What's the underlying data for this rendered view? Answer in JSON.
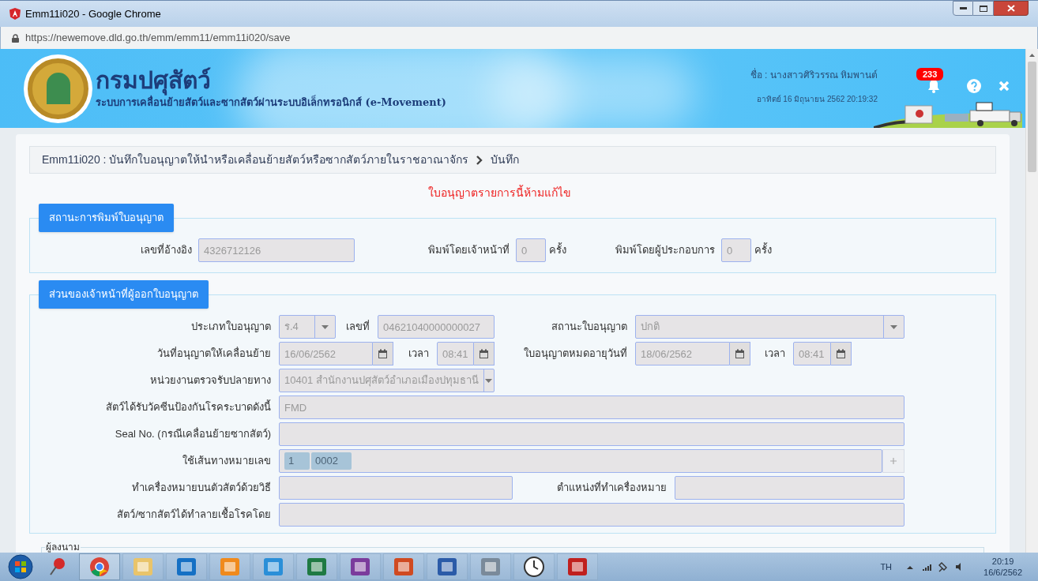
{
  "window": {
    "title": "Emm11i020 - Google Chrome",
    "url": "https://newemove.dld.go.th/emm/emm11/emm11i020/save"
  },
  "header": {
    "org_name": "กรมปศุสัตว์",
    "system_name": "ระบบการเคลื่อนย้ายสัตว์และซากสัตว์ผ่านระบบอิเล็กทรอนิกส์ (e-Movement)",
    "user_label": "ชื่อ :",
    "user_name": "นางสาวศิริวรรณ หิมพานต์",
    "datetime": "อาทิตย์ 16 มิถุนายน 2562 20:19:32",
    "notification_count": "233"
  },
  "breadcrumb": {
    "page": "Emm11i020 : บันทึกใบอนุญาตให้นำหรือเคลื่อนย้ายสัตว์หรือซากสัตว์ภายในราชอาณาจักร",
    "current": "บันทึก"
  },
  "notice": "ใบอนุญาตรายการนี้ห้ามแก้ไข",
  "print_status": {
    "heading": "สถานะการพิมพ์ใบอนุญาต",
    "fields": [
      {
        "label": "เลขที่อ้างอิง",
        "value": "4326712126"
      },
      {
        "label": "พิมพ์โดยเจ้าหน้าที่",
        "value": "0",
        "suffix": "ครั้ง"
      },
      {
        "label": "พิมพ์โดยผู้ประกอบการ",
        "value": "0",
        "suffix": "ครั้ง"
      }
    ]
  },
  "issuer_section": {
    "heading": "ส่วนของเจ้าหน้าที่ผู้ออกใบอนุญาต",
    "rows": [
      {
        "fields": [
          {
            "label": "ประเภทใบอนุญาต",
            "kind": "select",
            "value": "ร.4"
          },
          {
            "label": "เลขที่",
            "kind": "text",
            "value": "04621040000000027"
          },
          {
            "label": "สถานะใบอนุญาต",
            "kind": "select",
            "value": "ปกติ"
          }
        ]
      },
      {
        "fields": [
          {
            "label": "วันที่อนุญาตให้เคลื่อนย้าย",
            "kind": "date",
            "value": "16/06/2562"
          },
          {
            "label": "เวลา",
            "kind": "date",
            "value": "08:41"
          },
          {
            "label": "ใบอนุญาตหมดอายุวันที่",
            "kind": "date",
            "value": "18/06/2562"
          },
          {
            "label": "เวลา",
            "kind": "date",
            "value": "08:41"
          }
        ]
      },
      {
        "fields": [
          {
            "label": "หน่วยงานตรวจรับปลายทาง",
            "kind": "select",
            "value": "10401 สำนักงานปศุสัตว์อำเภอเมืองปทุมธานี"
          }
        ]
      },
      {
        "fields": [
          {
            "label": "สัตว์ได้รับวัคซีนป้องกันโรคระบาดดังนี้",
            "kind": "text",
            "value": "FMD"
          }
        ]
      },
      {
        "fields": [
          {
            "label": "Seal No. (กรณีเคลื่อนย้ายซากสัตว์)",
            "kind": "text"
          }
        ]
      },
      {
        "fields": [
          {
            "label": "ใช้เส้นทางหมายเลข",
            "kind": "tags",
            "tags": [
              "1",
              "0002"
            ]
          }
        ]
      },
      {
        "fields": [
          {
            "label": "ทำเครื่องหมายบนตัวสัตว์ด้วยวิธี",
            "kind": "text"
          },
          {
            "label": "ตำแหน่งที่ทำเครื่องหมาย",
            "kind": "text"
          }
        ]
      },
      {
        "fields": [
          {
            "label": "สัตว์/ซากสัตว์ได้ทำลายเชื้อโรคโดย",
            "kind": "text"
          }
        ]
      }
    ]
  },
  "signer_section": {
    "legend": "ผู้ลงนาม"
  },
  "taskbar": {
    "language": "TH",
    "time": "20:19",
    "date": "16/6/2562"
  }
}
